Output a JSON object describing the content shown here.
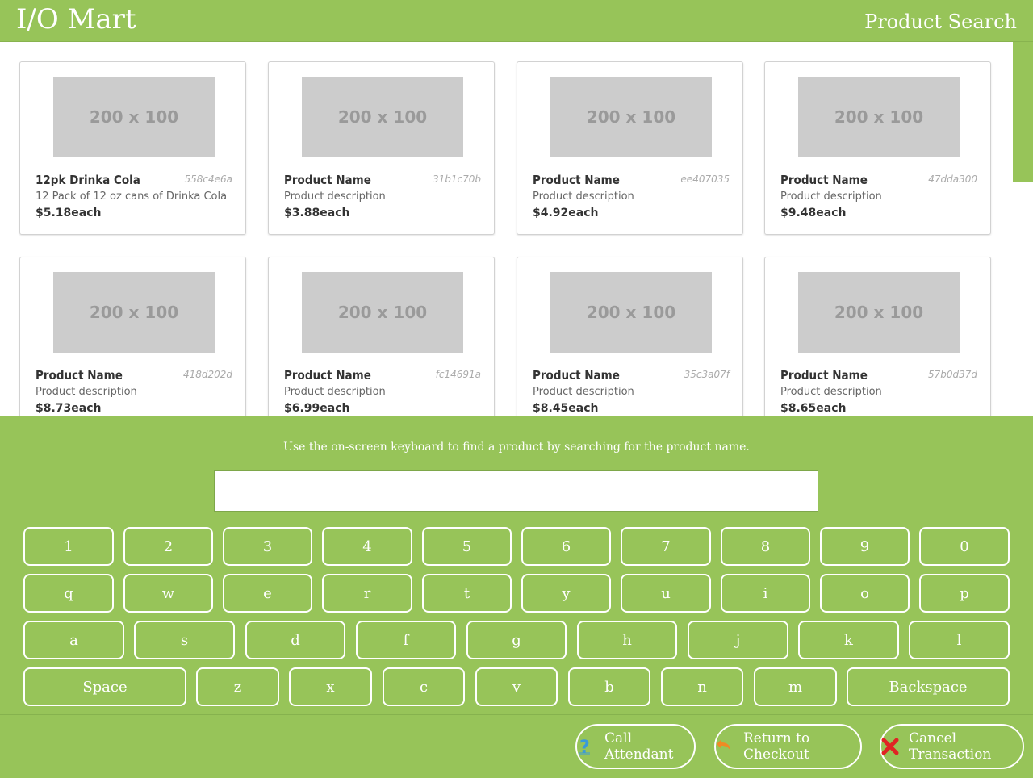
{
  "header": {
    "brand": "I/O Mart",
    "title": "Product Search"
  },
  "products": [
    {
      "name": "12pk Drinka Cola",
      "code": "558c4e6a",
      "description": "12 Pack of 12 oz cans of Drinka Cola",
      "price": "$5.18each",
      "image_text": "200 x 100"
    },
    {
      "name": "Product Name",
      "code": "31b1c70b",
      "description": "Product description",
      "price": "$3.88each",
      "image_text": "200 x 100"
    },
    {
      "name": "Product Name",
      "code": "ee407035",
      "description": "Product description",
      "price": "$4.92each",
      "image_text": "200 x 100"
    },
    {
      "name": "Product Name",
      "code": "47dda300",
      "description": "Product description",
      "price": "$9.48each",
      "image_text": "200 x 100"
    },
    {
      "name": "Product Name",
      "code": "418d202d",
      "description": "Product description",
      "price": "$8.73each",
      "image_text": "200 x 100"
    },
    {
      "name": "Product Name",
      "code": "fc14691a",
      "description": "Product description",
      "price": "$6.99each",
      "image_text": "200 x 100"
    },
    {
      "name": "Product Name",
      "code": "35c3a07f",
      "description": "Product description",
      "price": "$8.45each",
      "image_text": "200 x 100"
    },
    {
      "name": "Product Name",
      "code": "57b0d37d",
      "description": "Product description",
      "price": "$8.65each",
      "image_text": "200 x 100"
    }
  ],
  "search": {
    "instruction": "Use the on-screen keyboard to find a product by searching for the product name.",
    "value": "",
    "placeholder": ""
  },
  "keyboard": {
    "row1": [
      "1",
      "2",
      "3",
      "4",
      "5",
      "6",
      "7",
      "8",
      "9",
      "0"
    ],
    "row2": [
      "q",
      "w",
      "e",
      "r",
      "t",
      "y",
      "u",
      "i",
      "o",
      "p"
    ],
    "row3": [
      "a",
      "s",
      "d",
      "f",
      "g",
      "h",
      "j",
      "k",
      "l"
    ],
    "row4": [
      "Space",
      "z",
      "x",
      "c",
      "v",
      "b",
      "n",
      "m",
      "Backspace"
    ]
  },
  "actions": {
    "call_attendant": "Call Attendant",
    "return_checkout": "Return to Checkout",
    "cancel_transaction": "Cancel Transaction"
  },
  "colors": {
    "accent": "#97c459",
    "thumb": "#cccccc",
    "call_icon": "#3a9ad9",
    "return_icon": "#f08a24",
    "cancel_icon": "#e02424"
  }
}
